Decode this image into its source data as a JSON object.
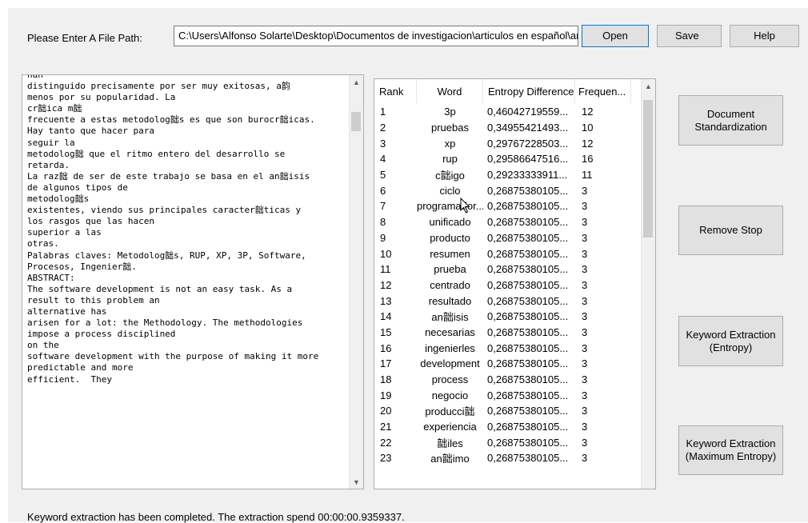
{
  "path": {
    "label": "Please Enter A File Path:",
    "value": "C:\\Users\\Alfonso Solarte\\Desktop\\Documentos de investigacion\\articulos en español\\artic"
  },
  "buttons": {
    "open": "Open",
    "save": "Save",
    "help": "Help",
    "standardization": "Document Standardization",
    "remove_stop": "Remove Stop",
    "keyword_entropy": "Keyword Extraction (Entropy)",
    "keyword_max_entropy": "Keyword Extraction (Maximum Entropy)"
  },
  "text_lines": [
    "han",
    "distinguido precisamente por ser muy exitosas, a韵",
    "menos por su popularidad. La",
    "cr韷ica m韷",
    "frecuente a estas metodolog韷s es que son burocr韷icas.",
    "Hay tanto que hacer para",
    "seguir la",
    "metodolog韷 que el ritmo entero del desarrollo se",
    "retarda.",
    "La raz韷 de ser de este trabajo se basa en el an韷isis",
    "de algunos tipos de",
    "metodolog韷s",
    "existentes, viendo sus principales caracter韷ticas y",
    "los rasgos que las hacen",
    "superior a las",
    "otras.",
    "Palabras claves: Metodolog韷s, RUP, XP, 3P, Software,",
    "Procesos, Ingenier韷.",
    "ABSTRACT:",
    "The software development is not an easy task. As a",
    "result to this problem an",
    "alternative has",
    "arisen for a lot: the Methodology. The methodologies",
    "impose a process disciplined",
    "on the",
    "software development with the purpose of making it more",
    "predictable and more",
    "efficient.  They"
  ],
  "table": {
    "headers": [
      "Rank",
      "Word",
      "Entropy Difference",
      "Frequen..."
    ],
    "rows": [
      [
        "1",
        "3p",
        "0,46042719559...",
        "12"
      ],
      [
        "2",
        "pruebas",
        "0,34955421493...",
        "10"
      ],
      [
        "3",
        "xp",
        "0,29767228503...",
        "12"
      ],
      [
        "4",
        "rup",
        "0,29586647516...",
        "16"
      ],
      [
        "5",
        "c韷igo",
        "0,29233333911...",
        "11"
      ],
      [
        "6",
        "ciclo",
        "0,26875380105...",
        "3"
      ],
      [
        "7",
        "programador...",
        "0,26875380105...",
        "3"
      ],
      [
        "8",
        "unificado",
        "0,26875380105...",
        "3"
      ],
      [
        "9",
        "producto",
        "0,26875380105...",
        "3"
      ],
      [
        "10",
        "resumen",
        "0,26875380105...",
        "3"
      ],
      [
        "11",
        "prueba",
        "0,26875380105...",
        "3"
      ],
      [
        "12",
        "centrado",
        "0,26875380105...",
        "3"
      ],
      [
        "13",
        "resultado",
        "0,26875380105...",
        "3"
      ],
      [
        "14",
        "an韷isis",
        "0,26875380105...",
        "3"
      ],
      [
        "15",
        "necesarias",
        "0,26875380105...",
        "3"
      ],
      [
        "16",
        "ingenierles",
        "0,26875380105...",
        "3"
      ],
      [
        "17",
        "development",
        "0,26875380105...",
        "3"
      ],
      [
        "18",
        "process",
        "0,26875380105...",
        "3"
      ],
      [
        "19",
        "negocio",
        "0,26875380105...",
        "3"
      ],
      [
        "20",
        "producci韷",
        "0,26875380105...",
        "3"
      ],
      [
        "21",
        "experiencia",
        "0,26875380105...",
        "3"
      ],
      [
        "22",
        "韷iles",
        "0,26875380105...",
        "3"
      ],
      [
        "23",
        "an韷imo",
        "0,26875380105...",
        "3"
      ]
    ]
  },
  "status": "Keyword extraction has been completed. The extraction spend 00:00:00.9359337."
}
